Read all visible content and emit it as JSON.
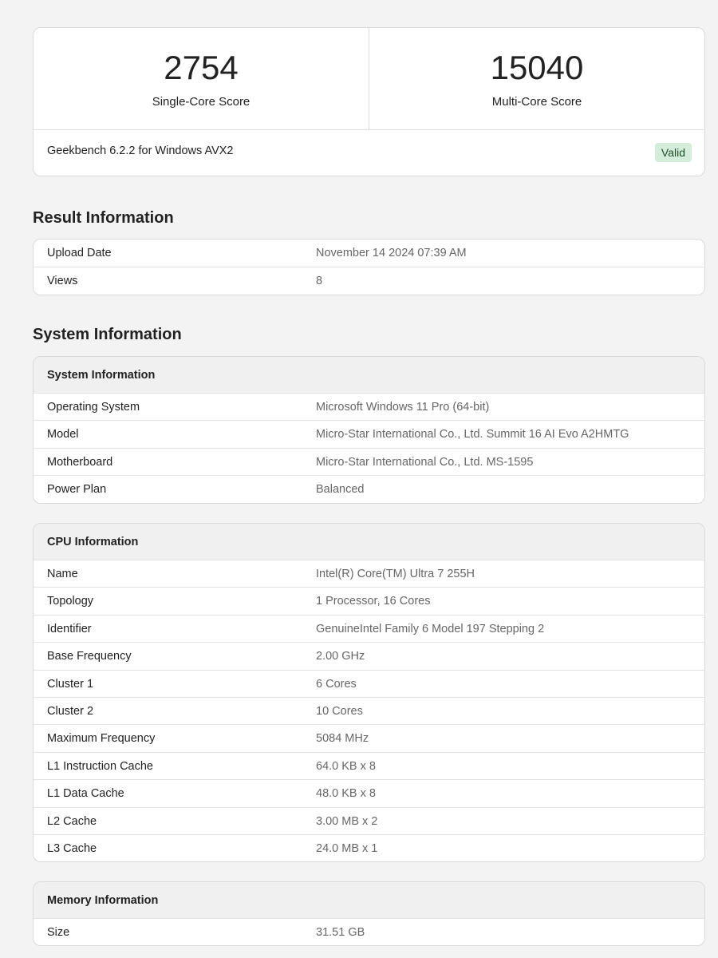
{
  "scores": {
    "single": {
      "value": "2754",
      "label": "Single-Core Score"
    },
    "multi": {
      "value": "15040",
      "label": "Multi-Core Score"
    },
    "version": "Geekbench 6.2.2 for Windows AVX2",
    "status": "Valid"
  },
  "colors": {
    "valid_bg": "#d4edda",
    "valid_text": "#1e4d2b"
  },
  "result_info": {
    "heading": "Result Information",
    "rows": [
      {
        "k": "Upload Date",
        "v": "November 14 2024 07:39 AM"
      },
      {
        "k": "Views",
        "v": "8"
      }
    ]
  },
  "system_info": {
    "heading": "System Information",
    "table_title": "System Information",
    "rows": [
      {
        "k": "Operating System",
        "v": "Microsoft Windows 11 Pro (64-bit)"
      },
      {
        "k": "Model",
        "v": "Micro-Star International Co., Ltd. Summit 16 AI Evo A2HMTG"
      },
      {
        "k": "Motherboard",
        "v": "Micro-Star International Co., Ltd. MS-1595"
      },
      {
        "k": "Power Plan",
        "v": "Balanced"
      }
    ]
  },
  "cpu_info": {
    "table_title": "CPU Information",
    "rows": [
      {
        "k": "Name",
        "v": "Intel(R) Core(TM) Ultra 7 255H"
      },
      {
        "k": "Topology",
        "v": "1 Processor, 16 Cores"
      },
      {
        "k": "Identifier",
        "v": "GenuineIntel Family 6 Model 197 Stepping 2"
      },
      {
        "k": "Base Frequency",
        "v": "2.00 GHz"
      },
      {
        "k": "Cluster 1",
        "v": "6 Cores"
      },
      {
        "k": "Cluster 2",
        "v": "10 Cores"
      },
      {
        "k": "Maximum Frequency",
        "v": "5084 MHz"
      },
      {
        "k": "L1 Instruction Cache",
        "v": "64.0 KB x 8"
      },
      {
        "k": "L1 Data Cache",
        "v": "48.0 KB x 8"
      },
      {
        "k": "L2 Cache",
        "v": "3.00 MB x 2"
      },
      {
        "k": "L3 Cache",
        "v": "24.0 MB x 1"
      }
    ]
  },
  "memory_info": {
    "table_title": "Memory Information",
    "rows": [
      {
        "k": "Size",
        "v": "31.51 GB"
      }
    ]
  }
}
